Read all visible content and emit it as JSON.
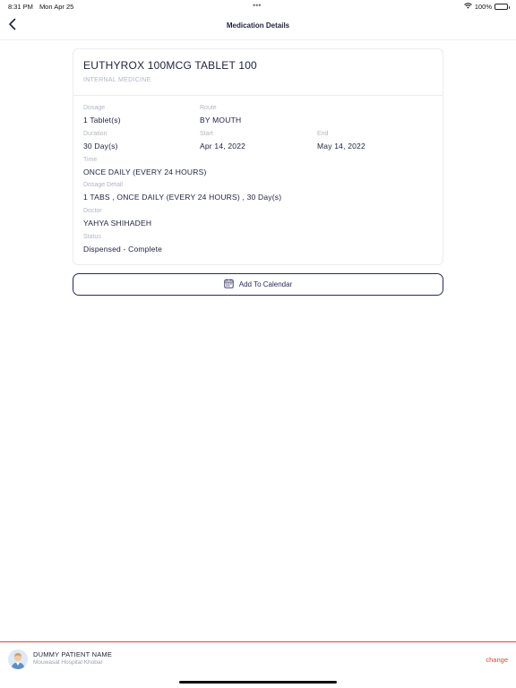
{
  "status_bar": {
    "time": "8:31 PM",
    "date": "Mon Apr 25",
    "dots": "•••",
    "battery": "100%",
    "icons": [
      "wifi-icon",
      "battery-icon"
    ]
  },
  "nav": {
    "title": "Medication Details",
    "back_icon": "chevron-left-icon"
  },
  "medication": {
    "name": "EUTHYROX 100MCG TABLET 100",
    "department": "INTERNAL MEDICINE",
    "dosage_label": "Dosage",
    "dosage": "1 Tablet(s)",
    "route_label": "Route",
    "route": "BY MOUTH",
    "duration_label": "Duration",
    "duration": "30 Day(s)",
    "start_label": "Start",
    "start": "Apr 14, 2022",
    "end_label": "End",
    "end": "May 14, 2022",
    "time_label": "Time",
    "time": "ONCE DAILY (EVERY 24 HOURS)",
    "dosage_detail_label": "Dosage Detail",
    "dosage_detail": "1 TABS , ONCE DAILY (EVERY 24 HOURS) , 30 Day(s)",
    "doctor_label": "Doctor",
    "doctor": "YAHYA SHIHADEH",
    "status_label": "Status",
    "status": "Dispensed - Complete"
  },
  "calendar_button": {
    "label": "Add To Calendar",
    "icon": "calendar-icon"
  },
  "footer": {
    "patient_name": "DUMMY PATIENT NAME",
    "hospital": "Mouwasat Hospital Khobar",
    "change_label": "change"
  },
  "colors": {
    "primary": "#1f2140",
    "accent": "#e8413c",
    "muted": "#b2b6c6",
    "button_border": "#2c2a5e"
  }
}
